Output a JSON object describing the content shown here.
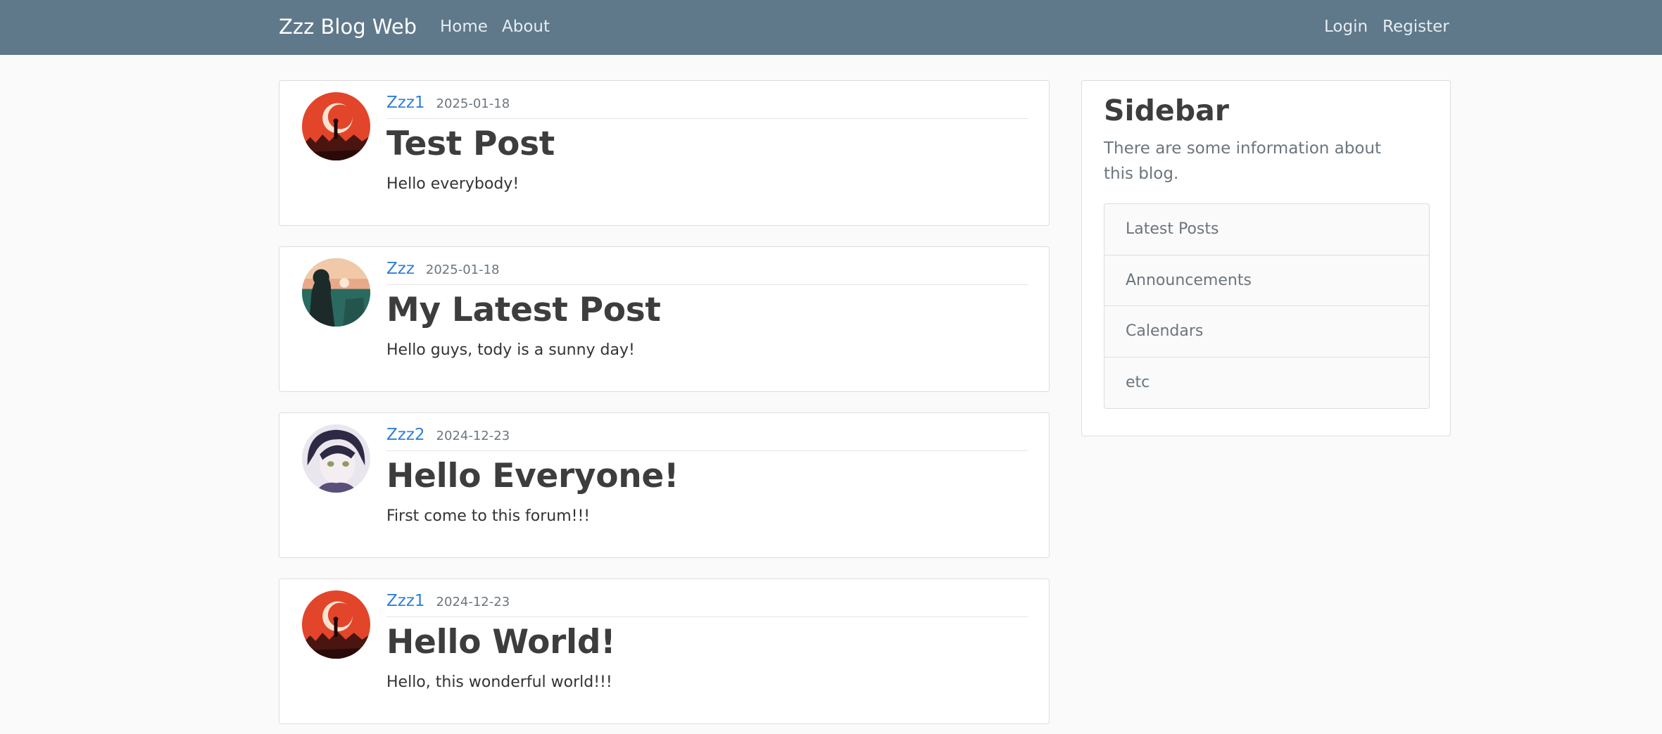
{
  "navbar": {
    "brand": "Zzz Blog Web",
    "links": [
      "Home",
      "About"
    ],
    "auth_links": [
      "Login",
      "Register"
    ],
    "background_color": "#5f788a"
  },
  "posts": [
    {
      "author": "Zzz1",
      "date": "2025-01-18",
      "title": "Test Post",
      "content": "Hello everybody!",
      "avatar": "red-moon-avatar"
    },
    {
      "author": "Zzz",
      "date": "2025-01-18",
      "title": "My Latest Post",
      "content": "Hello guys, tody is a sunny day!",
      "avatar": "teal-sunset-avatar"
    },
    {
      "author": "Zzz2",
      "date": "2024-12-23",
      "title": "Hello Everyone!",
      "content": "First come to this forum!!!",
      "avatar": "anime-girl-avatar"
    },
    {
      "author": "Zzz1",
      "date": "2024-12-23",
      "title": "Hello World!",
      "content": "Hello, this wonderful world!!!",
      "avatar": "red-moon-avatar"
    }
  ],
  "sidebar": {
    "title": "Sidebar",
    "description": "There are some information about this blog.",
    "items": [
      "Latest Posts",
      "Announcements",
      "Calendars",
      "etc"
    ]
  },
  "colors": {
    "link": "#2f7fd6",
    "page_background": "#fafafa"
  }
}
